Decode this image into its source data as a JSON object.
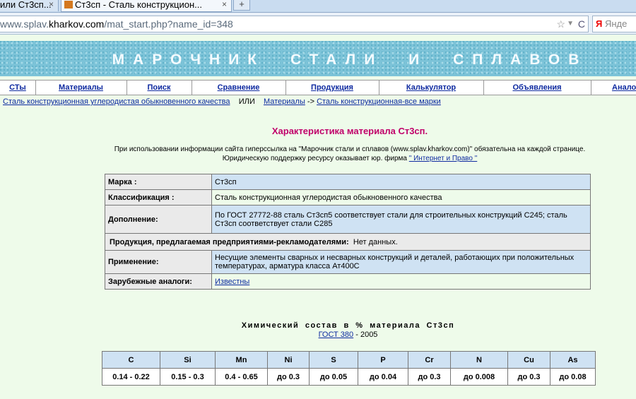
{
  "browser": {
    "tabs": [
      {
        "label": "или Ст3сп..."
      },
      {
        "label": "Ст3сп - Сталь конструкцион..."
      }
    ],
    "new_tab": "+",
    "close": "×",
    "url_prefix": "www.splav.",
    "url_domain": "kharkov.com",
    "url_path": "/mat_start.php?name_id=348",
    "search_placeholder": "Янде"
  },
  "banner": {
    "title": "МАРОЧНИК СТАЛИ И СПЛАВОВ"
  },
  "nav": {
    "items": [
      "СТы",
      "Материалы",
      "Поиск",
      "Сравнение",
      "Продукция",
      "Калькулятор",
      "Объявления",
      "Анало"
    ]
  },
  "breadcrumb": {
    "link1": "Сталь конструкционная углеродистая обыкновенного качества",
    "or": "ИЛИ",
    "link2": "Материалы",
    "arrow": "->",
    "link3": "Сталь конструкционная-все марки"
  },
  "page": {
    "heading": "Характеристика материала Ст3сп.",
    "notice_line1": "При использовании информации сайта гиперссылка на \"Марочник стали и сплавов (www.splav.kharkov.com)\" обязательна на каждой странице.",
    "notice_line2": "Юридическую поддержку ресурсу оказывает юр. фирма",
    "notice_link": "\" Интернет и Право \""
  },
  "props": {
    "marka_k": "Марка :",
    "marka_v": "Ст3сп",
    "class_k": "Классификация :",
    "class_v": "Сталь конструкционная углеродистая обыкновенного качества",
    "add_k": "Дополнение:",
    "add_v": "По ГОСТ 27772-88 сталь Ст3сп5 соответствует стали для строительных конструкций С245; сталь Ст3сп соответствует стали С285",
    "prod_k": "Продукция, предлагаемая предприятиями-рекламодателями:",
    "prod_v": "Нет данных.",
    "use_k": "Применение:",
    "use_v": "Несущие элементы сварных и несварных конструкций и деталей, работающих при положительных температурах, арматура класса Ат400С",
    "analog_k": "Зарубежные аналоги:",
    "analog_v": "Известны"
  },
  "chem": {
    "title": "Химический состав в % материала Ст3сп",
    "gost_link": "ГОСТ 380",
    "gost_year": "- 2005",
    "headers": [
      "C",
      "Si",
      "Mn",
      "Ni",
      "S",
      "P",
      "Cr",
      "N",
      "Cu",
      "As"
    ],
    "values": [
      "0.14 - 0.22",
      "0.15 - 0.3",
      "0.4 - 0.65",
      "до 0.3",
      "до 0.05",
      "до 0.04",
      "до 0.3",
      "до 0.008",
      "до 0.3",
      "до 0.08"
    ]
  }
}
